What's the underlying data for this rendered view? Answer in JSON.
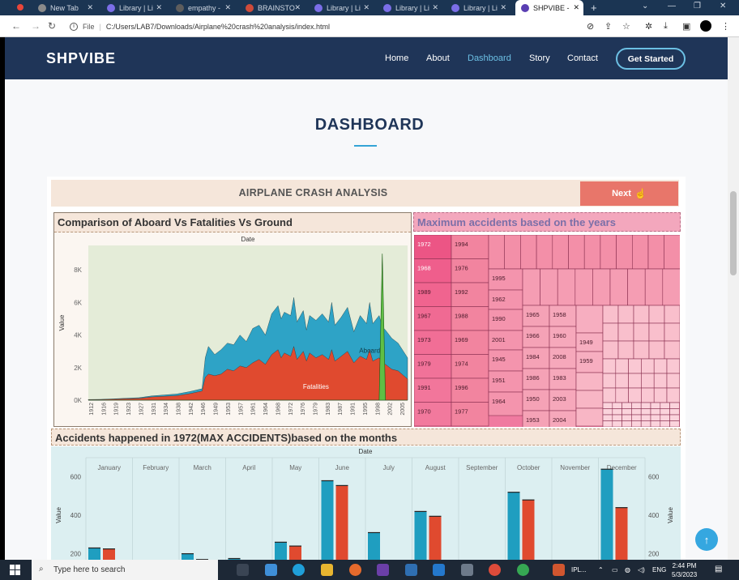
{
  "browser": {
    "tabs": [
      {
        "label": "New Tab",
        "color": "#8a8a8a"
      },
      {
        "label": "Library | Li",
        "color": "#7b6ee8"
      },
      {
        "label": "empathy -",
        "color": "#5d5d5d"
      },
      {
        "label": "BRAINSTO",
        "color": "#cf4b3a"
      },
      {
        "label": "Library | Li",
        "color": "#7b6ee8"
      },
      {
        "label": "Library | Li",
        "color": "#7b6ee8"
      },
      {
        "label": "Library | Li",
        "color": "#7b6ee8"
      },
      {
        "label": "SHPVIBE -",
        "color": "#5a3fb3"
      }
    ],
    "new_tab": "+",
    "url_prefix": "File",
    "url": "C:/Users/LAB7/Downloads/Airplane%20crash%20analysis/index.html"
  },
  "site": {
    "logo": "SHPVIBE",
    "nav": [
      "Home",
      "About",
      "Dashboard",
      "Story",
      "Contact"
    ],
    "cta": "Get Started",
    "section_title": "DASHBOARD"
  },
  "viz": {
    "header": "AIRPLANE CRASH ANALYSIS",
    "next": "Next",
    "area_title": "Comparison of Aboard Vs Fatalities Vs Ground",
    "tree_title": "Maximum accidents based on the years",
    "bar_title": "Accidents happened in 1972(MAX ACCIDENTS)based on the months"
  },
  "taskbar": {
    "search_placeholder": "Type here to search",
    "time": "2:44 PM",
    "date": "5/3/2023",
    "lang": "ENG",
    "pinned_label": "IPL..."
  },
  "chart_data": [
    {
      "type": "area",
      "title": "Comparison of Aboard Vs Fatalities Vs Ground",
      "xlabel": "Date",
      "ylabel": "Value",
      "ylim": [
        0,
        9500
      ],
      "yticks": [
        "0K",
        "2K",
        "4K",
        "6K",
        "8K"
      ],
      "ytick_values": [
        0,
        2000,
        4000,
        6000,
        8000
      ],
      "x_tick_labels": [
        "1912",
        "1916",
        "1919",
        "1923",
        "1927",
        "1931",
        "1934",
        "1938",
        "1942",
        "1946",
        "1949",
        "1953",
        "1957",
        "1961",
        "1964",
        "1968",
        "1972",
        "1976",
        "1979",
        "1983",
        "1987",
        "1991",
        "1995",
        "1998",
        "2002",
        "2005"
      ],
      "x": [
        1908,
        1912,
        1916,
        1920,
        1924,
        1928,
        1932,
        1936,
        1940,
        1944,
        1945,
        1946,
        1948,
        1950,
        1952,
        1954,
        1956,
        1958,
        1960,
        1962,
        1964,
        1966,
        1968,
        1969,
        1970,
        1972,
        1973,
        1974,
        1976,
        1977,
        1978,
        1980,
        1982,
        1984,
        1985,
        1986,
        1988,
        1990,
        1992,
        1994,
        1996,
        1997,
        1998,
        2000,
        2001,
        2002,
        2004,
        2006,
        2009
      ],
      "series": [
        {
          "name": "Aboard",
          "color": "#2ea3c6",
          "values": [
            40,
            50,
            80,
            120,
            150,
            260,
            320,
            380,
            520,
            700,
            2600,
            3300,
            2800,
            3100,
            3500,
            3400,
            4000,
            3600,
            4400,
            4600,
            4000,
            5300,
            5800,
            5000,
            5400,
            5200,
            6300,
            4800,
            5500,
            4300,
            5200,
            4900,
            5300,
            4800,
            6000,
            4600,
            5100,
            5700,
            4200,
            5200,
            4700,
            6000,
            4700,
            5200,
            4500,
            4300,
            3800,
            3500,
            2600
          ]
        },
        {
          "name": "Fatalities",
          "color": "#e04a2f",
          "values": [
            30,
            40,
            60,
            90,
            110,
            200,
            240,
            280,
            400,
            560,
            1400,
            1600,
            1500,
            1600,
            1900,
            1800,
            2100,
            2000,
            2300,
            2500,
            2200,
            2800,
            3100,
            2600,
            2900,
            2700,
            3300,
            2500,
            3000,
            2400,
            2900,
            2600,
            2800,
            2500,
            3100,
            2400,
            2700,
            3000,
            2300,
            2700,
            2500,
            3100,
            2400,
            2600,
            2300,
            2200,
            1900,
            1800,
            1300
          ]
        },
        {
          "name": "Ground",
          "color": "#5fbf45",
          "values": [
            0,
            0,
            0,
            0,
            0,
            0,
            0,
            0,
            0,
            0,
            0,
            0,
            0,
            0,
            0,
            0,
            0,
            0,
            0,
            0,
            0,
            0,
            0,
            0,
            0,
            0,
            0,
            0,
            0,
            0,
            0,
            0,
            0,
            0,
            0,
            0,
            0,
            0,
            0,
            0,
            0,
            0,
            0,
            0,
            9000,
            0,
            0,
            0,
            0
          ]
        }
      ]
    },
    {
      "type": "heatmap",
      "title": "Maximum accidents based on the years",
      "labeled_cells": [
        "1972",
        "1968",
        "1989",
        "1967",
        "1973",
        "1979",
        "1991",
        "1970",
        "1994",
        "1976",
        "1992",
        "1988",
        "1969",
        "1974",
        "1996",
        "1977",
        "1995",
        "1962",
        "1990",
        "2001",
        "1945",
        "1951",
        "1964",
        "1965",
        "1966",
        "1984",
        "1986",
        "1950",
        "1953",
        "1958",
        "1960",
        "2008",
        "1983",
        "2003",
        "2004",
        "1949",
        "1959",
        "1955",
        "1961"
      ]
    },
    {
      "type": "bar",
      "title": "Accidents happened in 1972(MAX ACCIDENTS)based on the months",
      "xlabel": "Date",
      "ylabel": "Value",
      "ylim": [
        0,
        700
      ],
      "categories": [
        "January",
        "February",
        "March",
        "April",
        "May",
        "June",
        "July",
        "August",
        "September",
        "October",
        "November",
        "December"
      ],
      "series": [
        {
          "name": "",
          "color": "#1f9ec0",
          "values": [
            230,
            0,
            200,
            175,
            260,
            580,
            310,
            420,
            0,
            520,
            0,
            640
          ]
        },
        {
          "name": "",
          "color": "#e04a2f",
          "values": [
            225,
            0,
            170,
            0,
            240,
            555,
            0,
            395,
            0,
            480,
            0,
            440
          ]
        }
      ],
      "yticks": [
        "200",
        "400",
        "600"
      ],
      "ytick_values": [
        200,
        400,
        600
      ]
    }
  ]
}
